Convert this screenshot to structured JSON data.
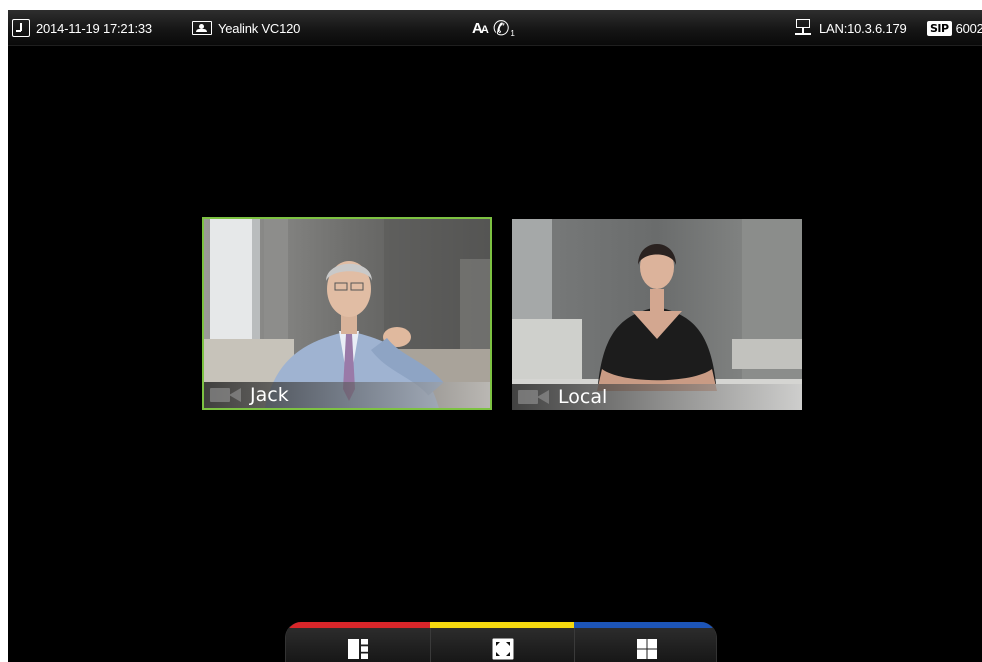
{
  "status_bar": {
    "datetime": "2014-11-19 17:21:33",
    "device_name": "Yealink VC120",
    "call_count": "1",
    "lan": "LAN:10.3.6.179",
    "sip_badge": "SIP",
    "sip_account": "6002",
    "icons": [
      "clock-icon",
      "device-icon",
      "font-size-icon",
      "handset-icon",
      "network-icon"
    ]
  },
  "video_tiles": [
    {
      "name": "Jack",
      "selected": true,
      "icon": "camera-icon"
    },
    {
      "name": "Local",
      "selected": false,
      "icon": "camera-icon"
    }
  ],
  "softkeys": [
    {
      "color": "#d8262a",
      "icon": "layout-split-icon"
    },
    {
      "color": "#f5d80f",
      "icon": "fullscreen-icon"
    },
    {
      "color": "#1d55b8",
      "icon": "grid-icon"
    }
  ],
  "colors": {
    "background": "#000000",
    "selection_border": "#7dc242"
  }
}
